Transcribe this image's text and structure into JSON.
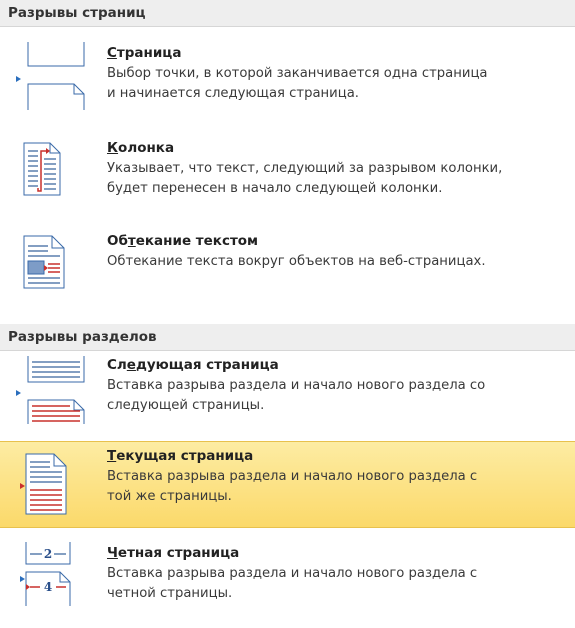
{
  "sections": {
    "page_breaks": {
      "title": "Разрывы страниц"
    },
    "section_breaks": {
      "title": "Разрывы разделов"
    }
  },
  "items": {
    "page": {
      "title_accel": "С",
      "title_rest": "траница",
      "desc": [
        "Выбор точки, в которой заканчивается одна страница",
        "и начинается следующая страница."
      ],
      "icon": "page-break-icon"
    },
    "column": {
      "title_accel": "К",
      "title_rest": "олонка",
      "desc": [
        "Указывает, что текст, следующий за разрывом колонки,",
        "будет перенесен в начало следующей колонки."
      ],
      "icon": "column-break-icon"
    },
    "text_wrap": {
      "title_pre": "Об",
      "title_accel": "т",
      "title_rest": "екание текстом",
      "desc": [
        "Обтекание текста вокруг объектов на веб-страницах."
      ],
      "icon": "text-wrapping-icon"
    },
    "next_page": {
      "title_pre": "Сл",
      "title_accel": "е",
      "title_rest": "дующая страница",
      "desc": [
        "Вставка разрыва раздела и начало нового раздела со",
        "следующей страницы."
      ],
      "icon": "next-page-section-icon"
    },
    "continuous": {
      "title_accel": "Т",
      "title_rest": "екущая страница",
      "desc": [
        "Вставка разрыва раздела и начало нового раздела с",
        "той же страницы."
      ],
      "icon": "continuous-section-icon",
      "selected": true
    },
    "even_page": {
      "title_accel": "Ч",
      "title_rest": "етная страница",
      "desc": [
        "Вставка разрыва раздела и начало нового раздела с",
        "четной страницы."
      ],
      "icon": "even-page-section-icon",
      "icon_numbers": [
        "2",
        "4"
      ]
    }
  },
  "colors": {
    "accent_blue": "#2a6ebd",
    "accent_red": "#c9302c",
    "highlight": "#fbd96a"
  }
}
